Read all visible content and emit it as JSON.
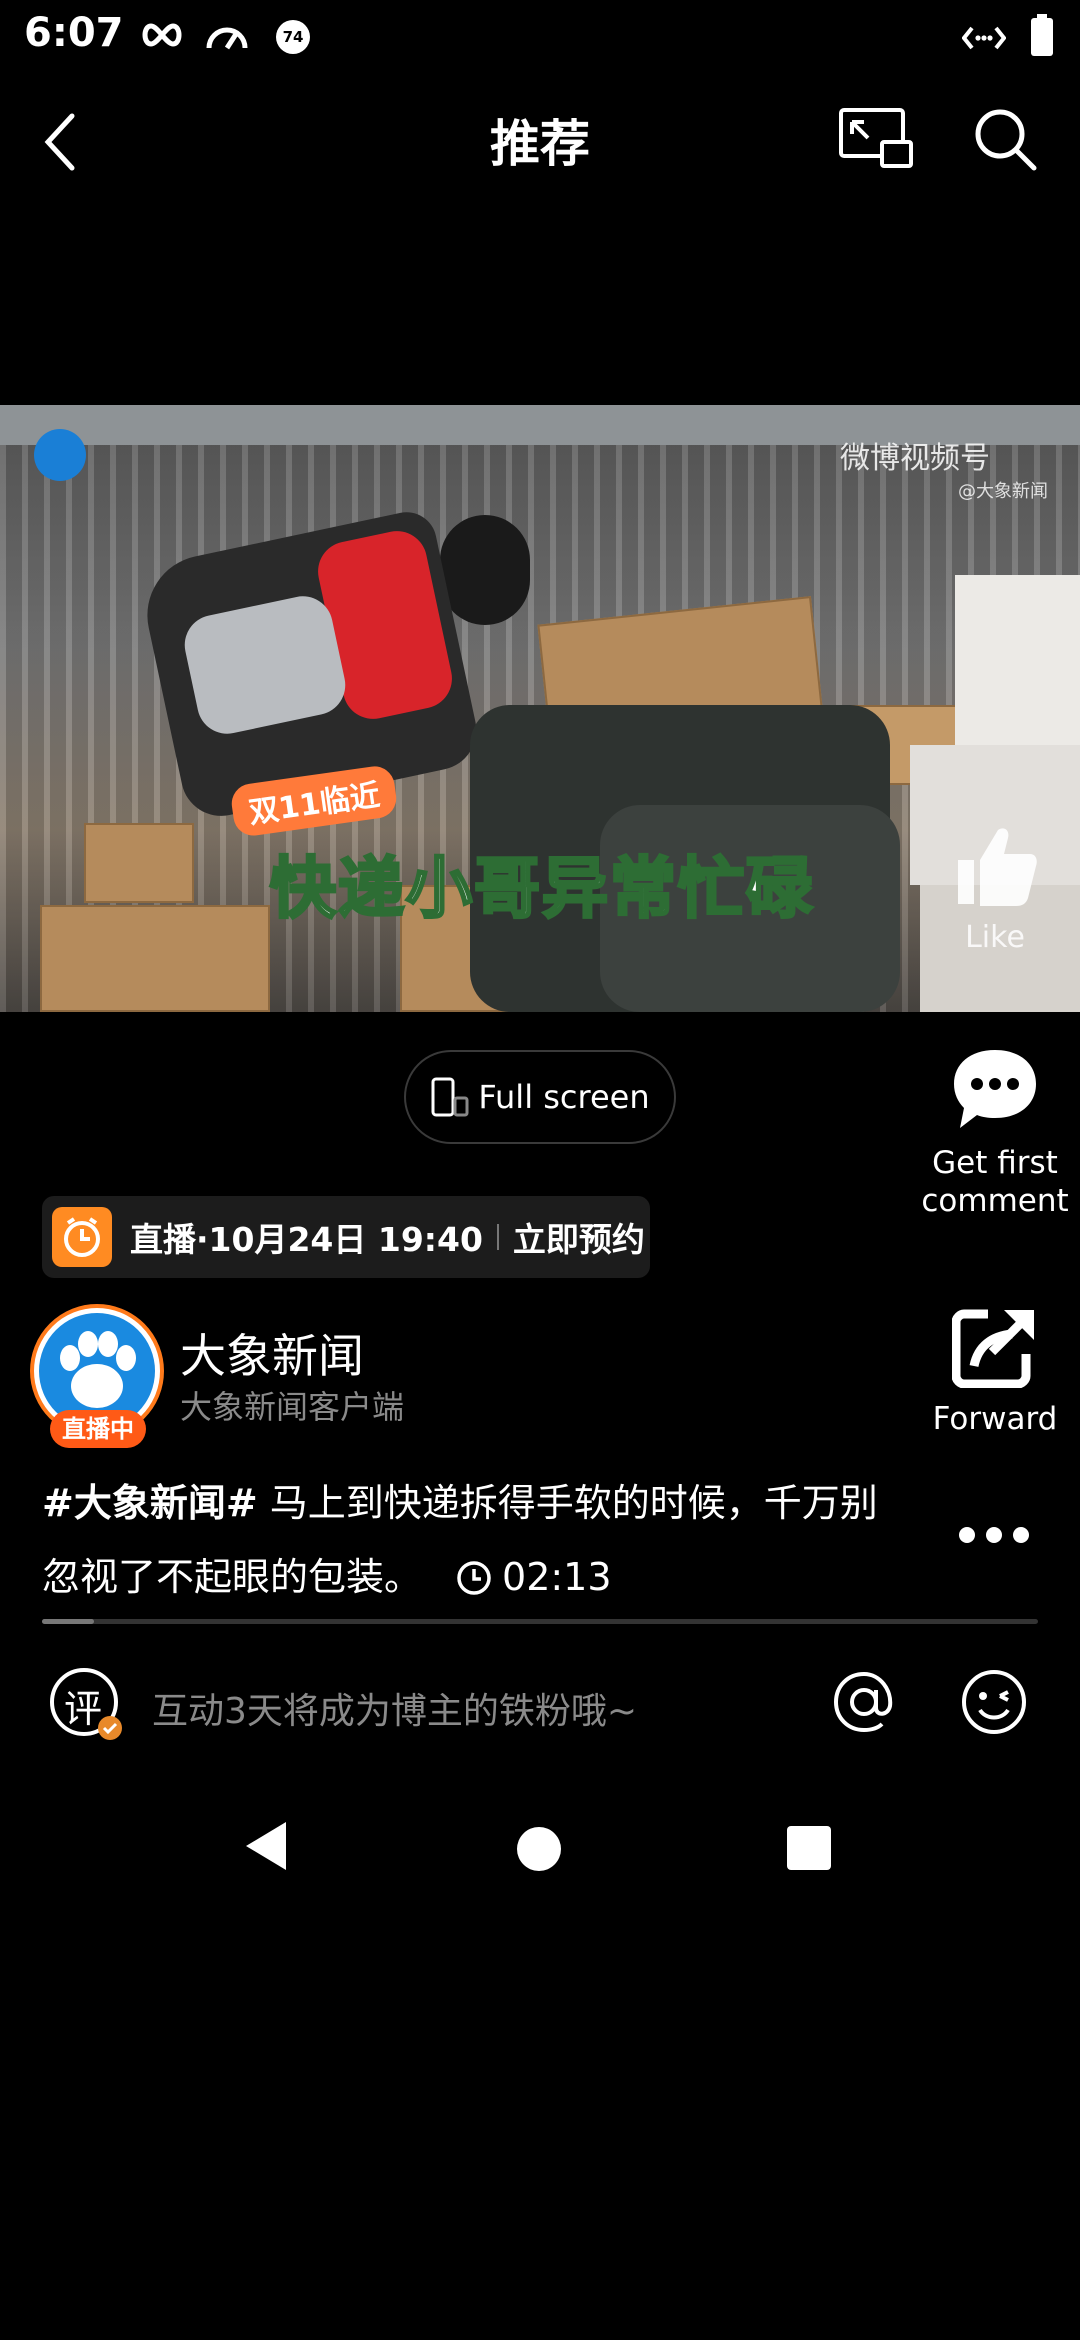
{
  "status_bar": {
    "time": "6:07",
    "badge_number": "74"
  },
  "header": {
    "title": "推荐"
  },
  "video": {
    "overlay_small": "双11临近",
    "overlay_big": "快递小哥异常忙碌",
    "watermark": "微博视频号",
    "watermark_sub": "@大象新闻"
  },
  "actions": {
    "like_label": "Like",
    "comment_label": "Get first comment",
    "forward_label": "Forward"
  },
  "fullscreen": {
    "label": "Full screen"
  },
  "appointment": {
    "text": "直播·10月24日 19:40",
    "action": "立即预约"
  },
  "author": {
    "name": "大象新闻",
    "subtitle": "大象新闻客户端",
    "live_badge": "直播中"
  },
  "caption": {
    "tag": "#大象新闻#",
    "text": " 马上到快递拆得手软的时候，千万别忽视了不起眼的包装。",
    "duration": "02:13"
  },
  "progress": {
    "fraction": 0.052
  },
  "comment_bar": {
    "icon_char": "评",
    "placeholder": "互动3天将成为博主的铁粉哦~"
  }
}
